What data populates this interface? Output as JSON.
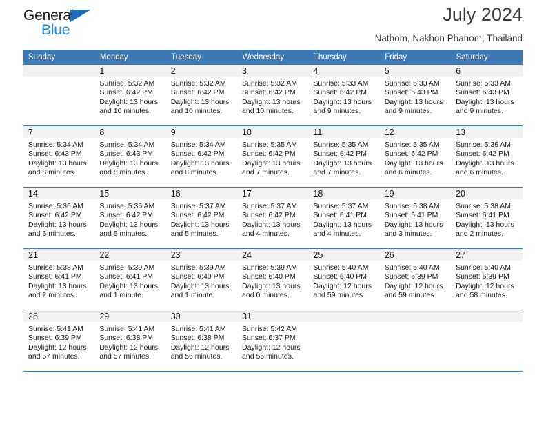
{
  "brand": {
    "name_top": "General",
    "name_bottom": "Blue",
    "triangle_color": "#1b6cb3",
    "blue_color": "#1b8ce3"
  },
  "header": {
    "title": "July 2024",
    "subtitle": "Nathom, Nakhon Phanom, Thailand",
    "header_bg_color": "#3b78b4",
    "daynum_bg_color": "#f2f2f2"
  },
  "weekdays": [
    "Sunday",
    "Monday",
    "Tuesday",
    "Wednesday",
    "Thursday",
    "Friday",
    "Saturday"
  ],
  "weeks": [
    [
      {
        "day": "",
        "lines": []
      },
      {
        "day": "1",
        "lines": [
          "Sunrise: 5:32 AM",
          "Sunset: 6:42 PM",
          "Daylight: 13 hours and 10 minutes."
        ]
      },
      {
        "day": "2",
        "lines": [
          "Sunrise: 5:32 AM",
          "Sunset: 6:42 PM",
          "Daylight: 13 hours and 10 minutes."
        ]
      },
      {
        "day": "3",
        "lines": [
          "Sunrise: 5:32 AM",
          "Sunset: 6:42 PM",
          "Daylight: 13 hours and 10 minutes."
        ]
      },
      {
        "day": "4",
        "lines": [
          "Sunrise: 5:33 AM",
          "Sunset: 6:42 PM",
          "Daylight: 13 hours and 9 minutes."
        ]
      },
      {
        "day": "5",
        "lines": [
          "Sunrise: 5:33 AM",
          "Sunset: 6:43 PM",
          "Daylight: 13 hours and 9 minutes."
        ]
      },
      {
        "day": "6",
        "lines": [
          "Sunrise: 5:33 AM",
          "Sunset: 6:43 PM",
          "Daylight: 13 hours and 9 minutes."
        ]
      }
    ],
    [
      {
        "day": "7",
        "lines": [
          "Sunrise: 5:34 AM",
          "Sunset: 6:43 PM",
          "Daylight: 13 hours and 8 minutes."
        ]
      },
      {
        "day": "8",
        "lines": [
          "Sunrise: 5:34 AM",
          "Sunset: 6:43 PM",
          "Daylight: 13 hours and 8 minutes."
        ]
      },
      {
        "day": "9",
        "lines": [
          "Sunrise: 5:34 AM",
          "Sunset: 6:42 PM",
          "Daylight: 13 hours and 8 minutes."
        ]
      },
      {
        "day": "10",
        "lines": [
          "Sunrise: 5:35 AM",
          "Sunset: 6:42 PM",
          "Daylight: 13 hours and 7 minutes."
        ]
      },
      {
        "day": "11",
        "lines": [
          "Sunrise: 5:35 AM",
          "Sunset: 6:42 PM",
          "Daylight: 13 hours and 7 minutes."
        ]
      },
      {
        "day": "12",
        "lines": [
          "Sunrise: 5:35 AM",
          "Sunset: 6:42 PM",
          "Daylight: 13 hours and 6 minutes."
        ]
      },
      {
        "day": "13",
        "lines": [
          "Sunrise: 5:36 AM",
          "Sunset: 6:42 PM",
          "Daylight: 13 hours and 6 minutes."
        ]
      }
    ],
    [
      {
        "day": "14",
        "lines": [
          "Sunrise: 5:36 AM",
          "Sunset: 6:42 PM",
          "Daylight: 13 hours and 6 minutes."
        ]
      },
      {
        "day": "15",
        "lines": [
          "Sunrise: 5:36 AM",
          "Sunset: 6:42 PM",
          "Daylight: 13 hours and 5 minutes."
        ]
      },
      {
        "day": "16",
        "lines": [
          "Sunrise: 5:37 AM",
          "Sunset: 6:42 PM",
          "Daylight: 13 hours and 5 minutes."
        ]
      },
      {
        "day": "17",
        "lines": [
          "Sunrise: 5:37 AM",
          "Sunset: 6:42 PM",
          "Daylight: 13 hours and 4 minutes."
        ]
      },
      {
        "day": "18",
        "lines": [
          "Sunrise: 5:37 AM",
          "Sunset: 6:41 PM",
          "Daylight: 13 hours and 4 minutes."
        ]
      },
      {
        "day": "19",
        "lines": [
          "Sunrise: 5:38 AM",
          "Sunset: 6:41 PM",
          "Daylight: 13 hours and 3 minutes."
        ]
      },
      {
        "day": "20",
        "lines": [
          "Sunrise: 5:38 AM",
          "Sunset: 6:41 PM",
          "Daylight: 13 hours and 2 minutes."
        ]
      }
    ],
    [
      {
        "day": "21",
        "lines": [
          "Sunrise: 5:38 AM",
          "Sunset: 6:41 PM",
          "Daylight: 13 hours and 2 minutes."
        ]
      },
      {
        "day": "22",
        "lines": [
          "Sunrise: 5:39 AM",
          "Sunset: 6:41 PM",
          "Daylight: 13 hours and 1 minute."
        ]
      },
      {
        "day": "23",
        "lines": [
          "Sunrise: 5:39 AM",
          "Sunset: 6:40 PM",
          "Daylight: 13 hours and 1 minute."
        ]
      },
      {
        "day": "24",
        "lines": [
          "Sunrise: 5:39 AM",
          "Sunset: 6:40 PM",
          "Daylight: 13 hours and 0 minutes."
        ]
      },
      {
        "day": "25",
        "lines": [
          "Sunrise: 5:40 AM",
          "Sunset: 6:40 PM",
          "Daylight: 12 hours and 59 minutes."
        ]
      },
      {
        "day": "26",
        "lines": [
          "Sunrise: 5:40 AM",
          "Sunset: 6:39 PM",
          "Daylight: 12 hours and 59 minutes."
        ]
      },
      {
        "day": "27",
        "lines": [
          "Sunrise: 5:40 AM",
          "Sunset: 6:39 PM",
          "Daylight: 12 hours and 58 minutes."
        ]
      }
    ],
    [
      {
        "day": "28",
        "lines": [
          "Sunrise: 5:41 AM",
          "Sunset: 6:39 PM",
          "Daylight: 12 hours and 57 minutes."
        ]
      },
      {
        "day": "29",
        "lines": [
          "Sunrise: 5:41 AM",
          "Sunset: 6:38 PM",
          "Daylight: 12 hours and 57 minutes."
        ]
      },
      {
        "day": "30",
        "lines": [
          "Sunrise: 5:41 AM",
          "Sunset: 6:38 PM",
          "Daylight: 12 hours and 56 minutes."
        ]
      },
      {
        "day": "31",
        "lines": [
          "Sunrise: 5:42 AM",
          "Sunset: 6:37 PM",
          "Daylight: 12 hours and 55 minutes."
        ]
      },
      {
        "day": "",
        "lines": []
      },
      {
        "day": "",
        "lines": []
      },
      {
        "day": "",
        "lines": []
      }
    ]
  ]
}
